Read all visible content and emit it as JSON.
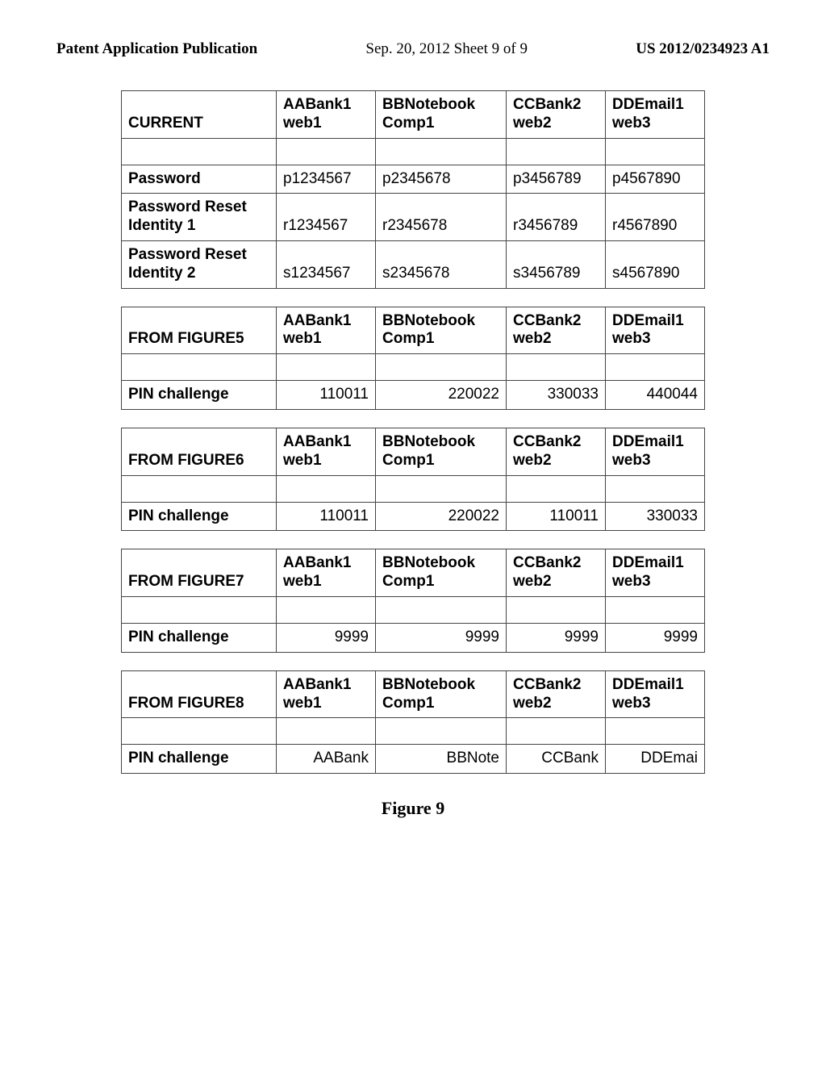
{
  "header": {
    "left": "Patent Application Publication",
    "center": "Sep. 20, 2012  Sheet 9 of 9",
    "right": "US 2012/0234923 A1"
  },
  "columns": {
    "c2a": "AABank1",
    "c2b": "web1",
    "c3a": "BBNotebook",
    "c3b": "Comp1",
    "c4a": "CCBank2",
    "c4b": "web2",
    "c5a": "DDEmail1",
    "c5b": "web3"
  },
  "tables": [
    {
      "title": "CURRENT",
      "rows": [
        {
          "label": "Password",
          "vals": [
            "p1234567",
            "p2345678",
            "p3456789",
            "p4567890"
          ],
          "align": "left"
        },
        {
          "label_a": "Password Reset",
          "label_b": "Identity 1",
          "vals": [
            "r1234567",
            "r2345678",
            "r3456789",
            "r4567890"
          ],
          "align": "left"
        },
        {
          "label_a": "Password Reset",
          "label_b": "Identity 2",
          "vals": [
            "s1234567",
            "s2345678",
            "s3456789",
            "s4567890"
          ],
          "align": "left"
        }
      ]
    },
    {
      "title": "FROM FIGURE5",
      "rows": [
        {
          "label": "PIN challenge",
          "vals": [
            "110011",
            "220022",
            "330033",
            "440044"
          ],
          "align": "right"
        }
      ]
    },
    {
      "title": "FROM FIGURE6",
      "rows": [
        {
          "label": "PIN challenge",
          "vals": [
            "110011",
            "220022",
            "110011",
            "330033"
          ],
          "align": "right"
        }
      ]
    },
    {
      "title": "FROM FIGURE7",
      "rows": [
        {
          "label": "PIN challenge",
          "vals": [
            "9999",
            "9999",
            "9999",
            "9999"
          ],
          "align": "right"
        }
      ]
    },
    {
      "title": "FROM FIGURE8",
      "rows": [
        {
          "label": "PIN challenge",
          "vals": [
            "AABank",
            "BBNote",
            "CCBank",
            "DDEmai"
          ],
          "align": "right"
        }
      ]
    }
  ],
  "caption": "Figure 9"
}
